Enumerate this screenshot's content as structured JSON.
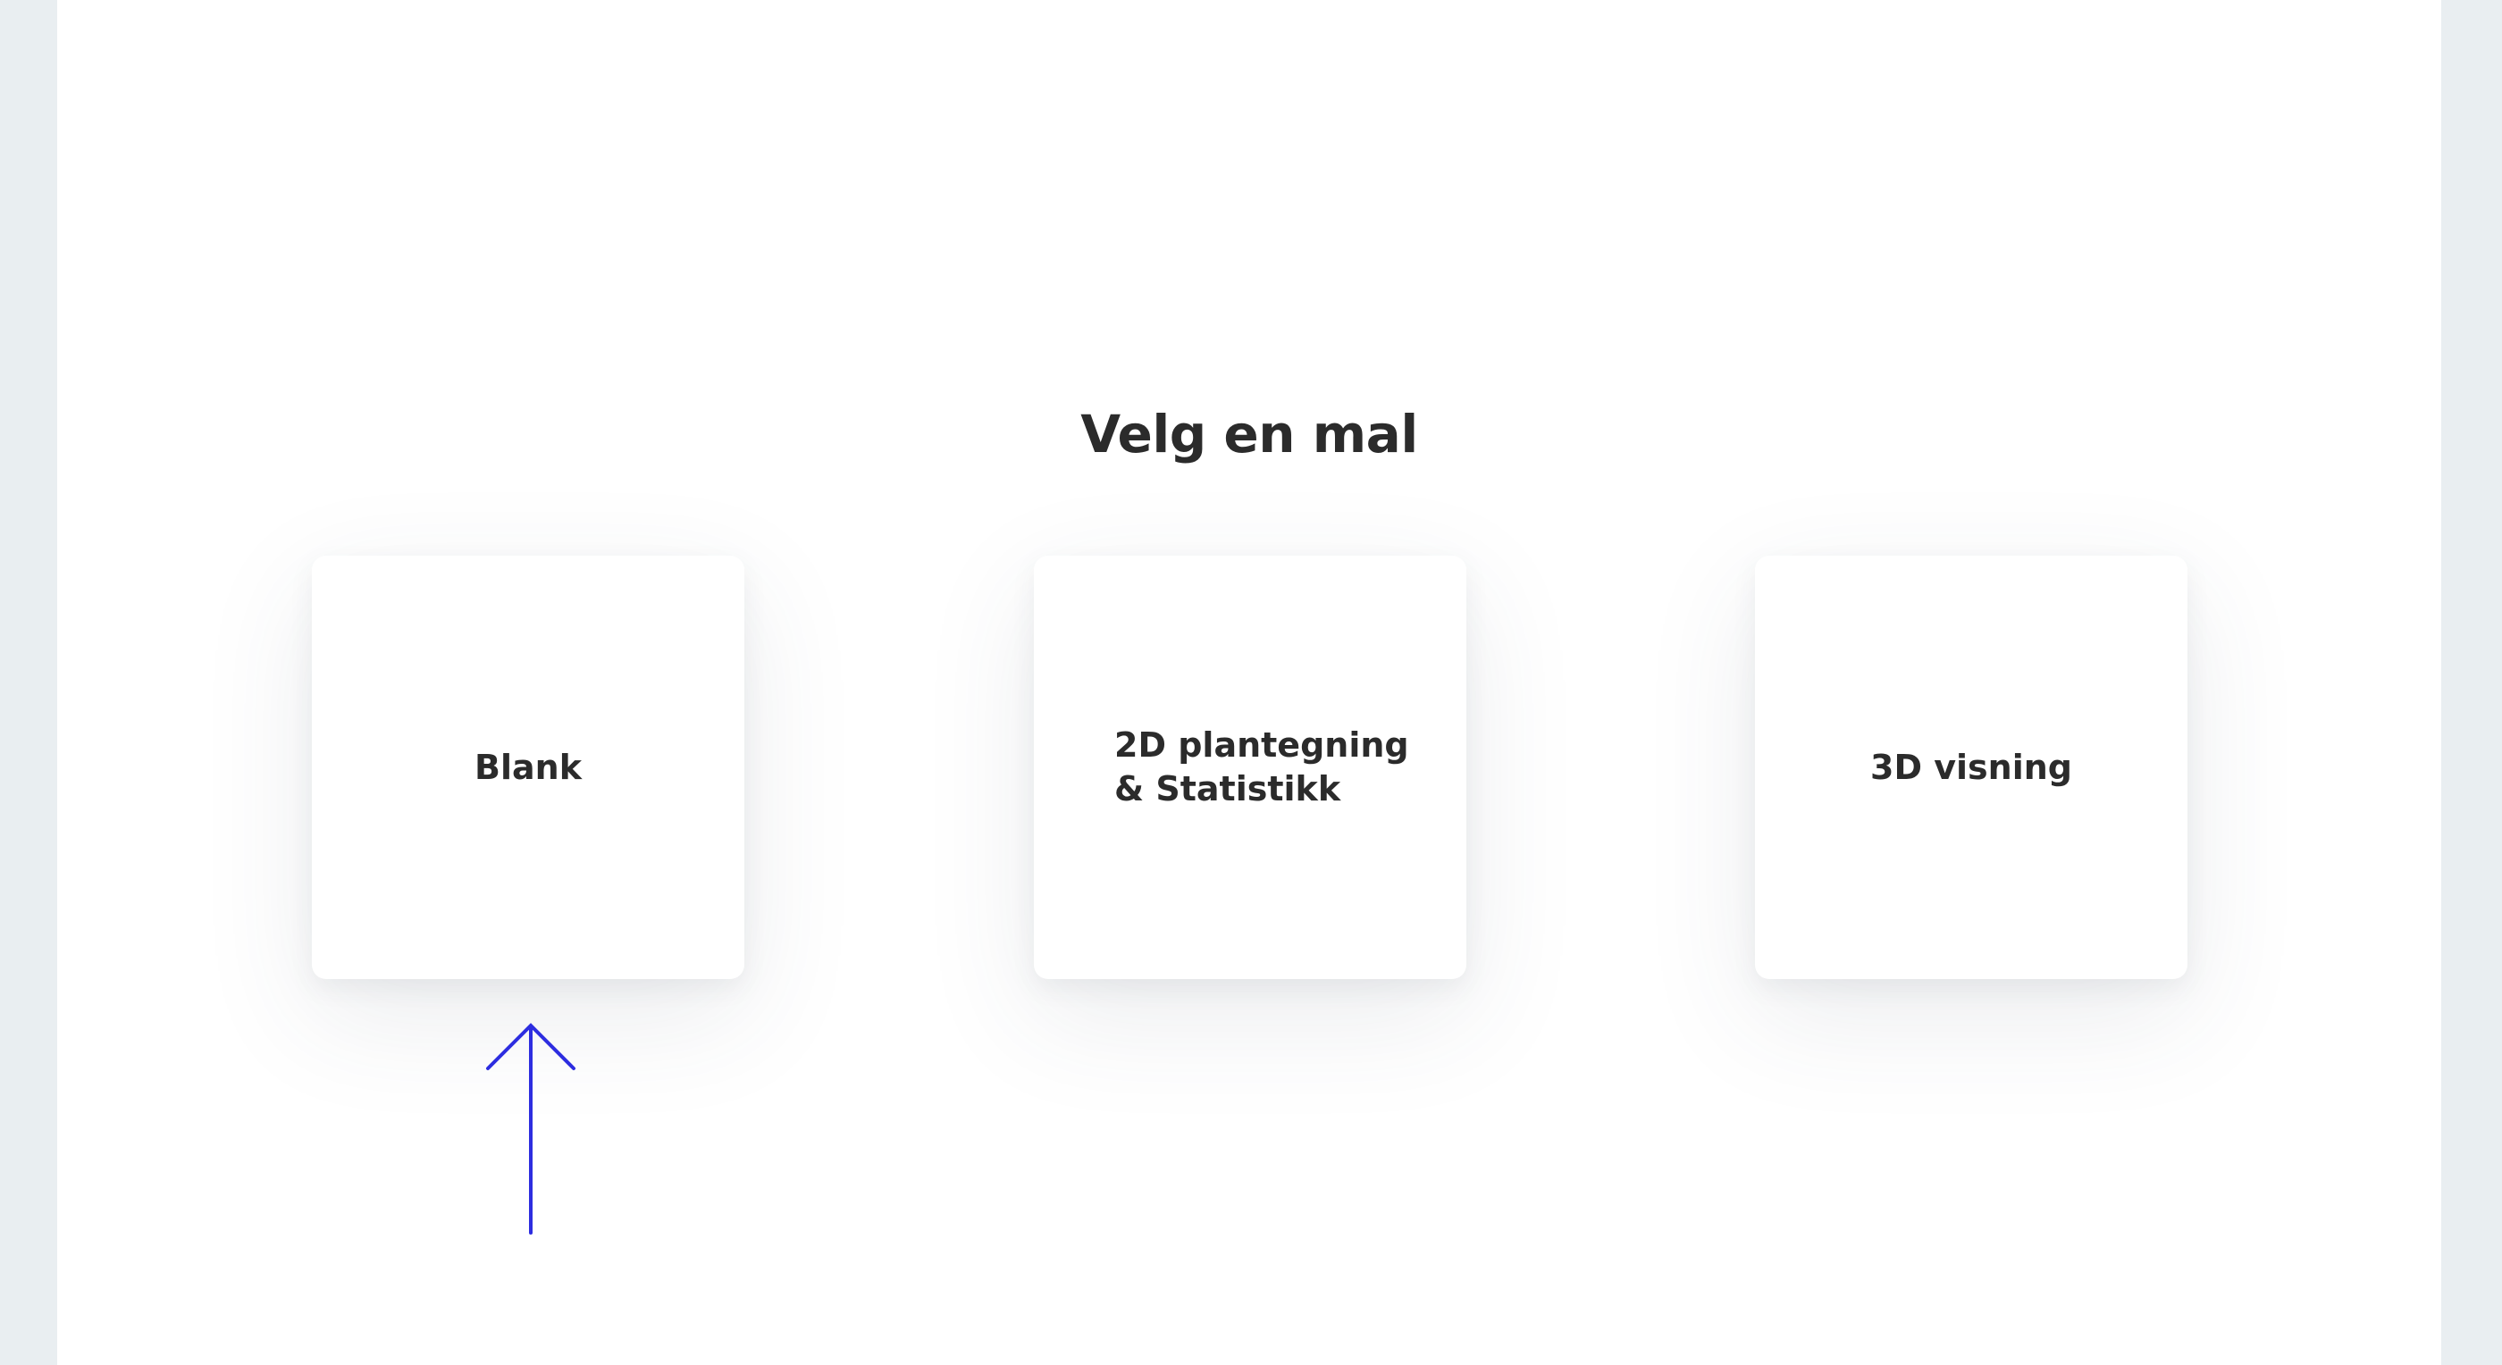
{
  "page": {
    "title": "Velg en mal"
  },
  "templates": [
    {
      "label": "Blank"
    },
    {
      "label": "2D plantegning\n& Statistikk"
    },
    {
      "label": "3D visning"
    }
  ],
  "indicator": {
    "icon": "arrow-up-icon",
    "color": "#2d2de0"
  },
  "colors": {
    "background": "#e9eef1",
    "panel": "#ffffff",
    "text": "#2b2b2b",
    "accent": "#2d2de0"
  }
}
